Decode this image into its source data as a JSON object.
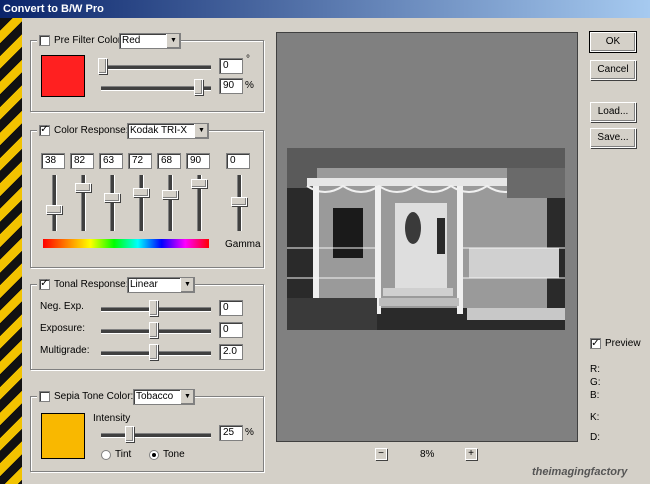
{
  "window": {
    "title": "Convert to B/W Pro"
  },
  "pre_filter": {
    "label": "Pre Filter Color:",
    "checked": false,
    "color_option": "Red",
    "swatch_color": "#ff2020",
    "hue_value": "0",
    "hue_unit": "°",
    "strength_value": "90",
    "strength_unit": "%",
    "hue_slider_pos": 0.0,
    "strength_slider_pos": 0.9
  },
  "color_response": {
    "label": "Color Response:",
    "checked": true,
    "preset": "Kodak TRI-X",
    "values": [
      "38",
      "82",
      "63",
      "72",
      "68",
      "90"
    ],
    "slider_levels": [
      0.38,
      0.82,
      0.63,
      0.72,
      0.68,
      0.9
    ],
    "gamma_value": "0",
    "gamma_label": "Gamma",
    "gamma_slider_level": 0.5
  },
  "tonal_response": {
    "label": "Tonal Response:",
    "checked": true,
    "mode": "Linear",
    "rows": [
      {
        "label": "Neg. Exp.",
        "value": "0",
        "level": 0.5
      },
      {
        "label": "Exposure:",
        "value": "0",
        "level": 0.5
      },
      {
        "label": "Multigrade:",
        "value": "2.0",
        "level": 0.5
      }
    ]
  },
  "sepia": {
    "label": "Sepia Tone Color:",
    "checked": false,
    "color_option": "Tobacco",
    "swatch_color": "#f9b800",
    "intensity_label": "Intensity",
    "intensity_value": "25",
    "intensity_unit": "%",
    "intensity_level": 0.25,
    "tint_label": "Tint",
    "tone_label": "Tone",
    "selected": "Tone"
  },
  "buttons": {
    "ok": "OK",
    "cancel": "Cancel",
    "load": "Load...",
    "save": "Save..."
  },
  "preview": {
    "label": "Preview",
    "checked": true,
    "zoom": "8%",
    "zoom_out": "−",
    "zoom_in": "+",
    "channels": [
      "R:",
      "G:",
      "B:",
      "K:",
      "D:"
    ]
  },
  "branding": {
    "logo_text": "theimagingfactory"
  }
}
